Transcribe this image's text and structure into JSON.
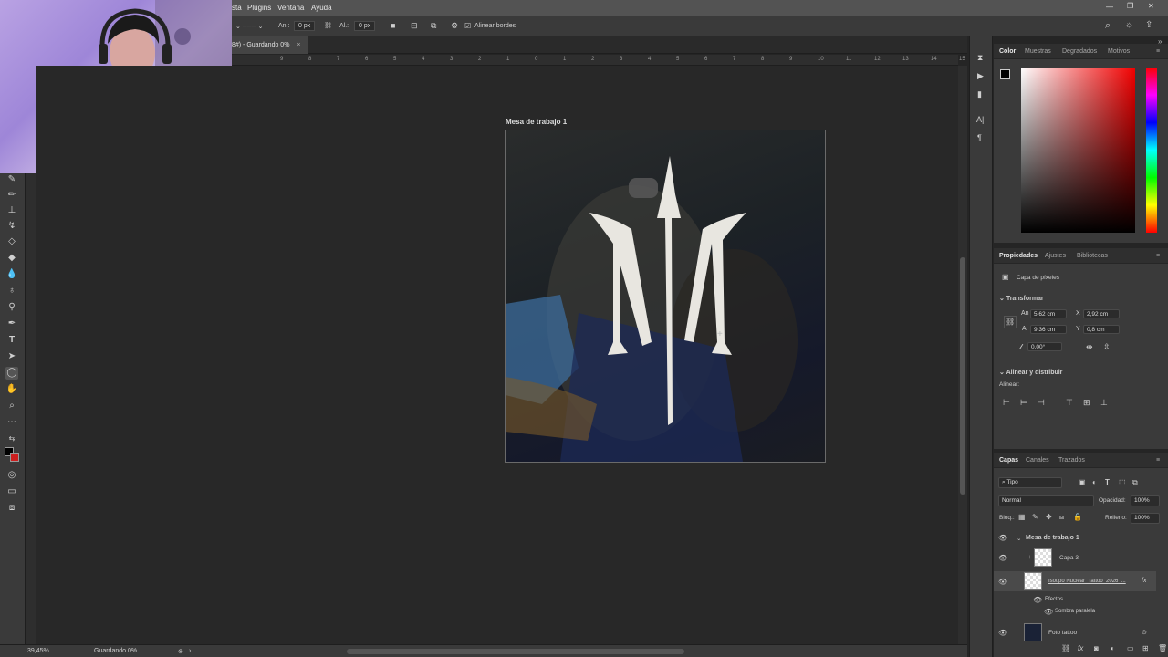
{
  "menu": {
    "items": [
      "sta",
      "Plugins",
      "Ventana",
      "Ayuda"
    ]
  },
  "options_bar": {
    "width_label": "An.:",
    "width_value": "0 px",
    "height_label": "Al.:",
    "height_value": "0 px",
    "align_edges_label": "Alinear bordes"
  },
  "document": {
    "tab_title": "8#) - Guardando 0%",
    "tab_close": "×"
  },
  "ruler_top": [
    "9",
    "8",
    "7",
    "6",
    "5",
    "4",
    "3",
    "2",
    "1",
    "0",
    "1",
    "2",
    "3",
    "4",
    "5",
    "6",
    "7",
    "8",
    "9",
    "10",
    "11",
    "12",
    "13",
    "14",
    "15"
  ],
  "artboard": {
    "label": "Mesa de trabajo 1"
  },
  "status_bar": {
    "zoom": "39,45%",
    "message": "Guardando 0%"
  },
  "color_panel": {
    "tabs": [
      "Color",
      "Muestras",
      "Degradados",
      "Motivos"
    ],
    "active_tab": "Color",
    "foreground": "#000000",
    "background": "#cc1e1e"
  },
  "properties_panel": {
    "tabs": [
      "Propiedades",
      "Ajustes",
      "Bibliotecas"
    ],
    "active_tab": "Propiedades",
    "layer_kind": "Capa de píxeles",
    "transform": {
      "title": "Transformar",
      "an_label": "An",
      "an_value": "5,62 cm",
      "x_label": "X",
      "x_value": "2,92 cm",
      "al_label": "Al",
      "al_value": "9,36 cm",
      "y_label": "Y",
      "y_value": "0,8 cm",
      "angle_value": "0,00°"
    },
    "align": {
      "title": "Alinear y distribuir",
      "subtitle": "Alinear:",
      "more": "..."
    }
  },
  "layers_panel": {
    "tabs": [
      "Capas",
      "Canales",
      "Trazados"
    ],
    "active_tab": "Capas",
    "filter_label": "Tipo",
    "blend_mode": "Normal",
    "opacity_label": "Opacidad:",
    "opacity_value": "100%",
    "lock_label": "Bloq.:",
    "fill_label": "Relleno:",
    "fill_value": "100%",
    "layers": [
      {
        "name": "Mesa de trabajo 1"
      },
      {
        "name": "Capa 3"
      },
      {
        "name": "Isotipo Nuclear_Tattoo_2026_...",
        "fx": "fx"
      },
      {
        "name": "Efectos"
      },
      {
        "name": "Sombra paralela"
      },
      {
        "name": "Foto tattoo"
      }
    ]
  }
}
